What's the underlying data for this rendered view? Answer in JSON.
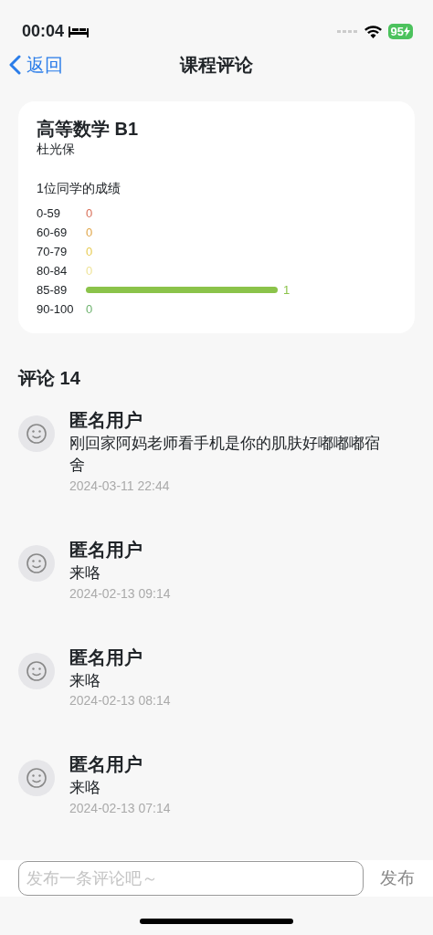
{
  "status_bar": {
    "time": "00:04",
    "battery": "95"
  },
  "nav": {
    "back": "返回",
    "title": "课程评论"
  },
  "course": {
    "name": "高等数学 B1",
    "teacher": "杜光保",
    "summary": "1位同学的成绩",
    "grades": [
      {
        "range": "0-59",
        "count": "0",
        "color": "#d9705a"
      },
      {
        "range": "60-69",
        "count": "0",
        "color": "#e0a64a"
      },
      {
        "range": "70-79",
        "count": "0",
        "color": "#e8cc55"
      },
      {
        "range": "80-84",
        "count": "0",
        "color": "#efe49a"
      },
      {
        "range": "85-89",
        "count": "1",
        "color": "#8bc34a"
      },
      {
        "range": "90-100",
        "count": "0",
        "color": "#6fb36f"
      }
    ]
  },
  "comments_header": "评论 14",
  "comments": [
    {
      "user": "匿名用户",
      "text": "刚回家阿妈老师看手机是你的肌肤好嘟嘟嘟宿舍",
      "date": "2024-03-11 22:44"
    },
    {
      "user": "匿名用户",
      "text": "来咯",
      "date": "2024-02-13 09:14"
    },
    {
      "user": "匿名用户",
      "text": "来咯",
      "date": "2024-02-13 08:14"
    },
    {
      "user": "匿名用户",
      "text": "来咯",
      "date": "2024-02-13 07:14"
    }
  ],
  "composer": {
    "placeholder": "发布一条评论吧～",
    "submit": "发布"
  }
}
